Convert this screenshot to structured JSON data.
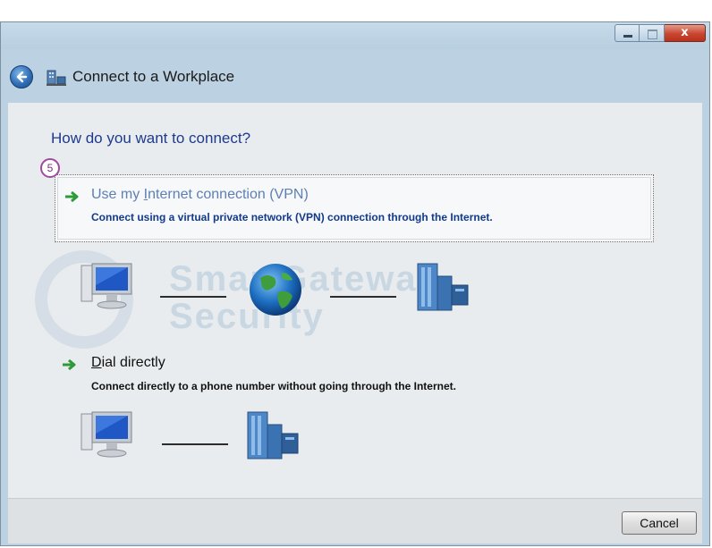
{
  "window": {
    "title": "Connect to a Workplace",
    "controls": {
      "minimize_icon": "minimize-icon",
      "maximize_icon": "maximize-icon",
      "close_glyph": "x"
    }
  },
  "nav": {
    "back_icon": "back-arrow-icon",
    "app_icon": "network-workplace-icon"
  },
  "main": {
    "heading": "How do you want to connect?",
    "step_badge": "5",
    "options": [
      {
        "title_prefix": "Use my ",
        "title_accel": "I",
        "title_suffix": "nternet connection (VPN)",
        "description": "Connect using a virtual private network (VPN) connection through the Internet.",
        "icons": [
          "computer-icon",
          "globe-icon",
          "server-icon"
        ]
      },
      {
        "title_accel": "D",
        "title_suffix": "ial directly",
        "description": "Connect directly to a phone number without going through the Internet.",
        "icons": [
          "computer-icon",
          "server-icon"
        ]
      }
    ]
  },
  "watermark": {
    "line1": "SmartGateway",
    "line2": "Security"
  },
  "footer": {
    "cancel_label": "Cancel"
  },
  "colors": {
    "heading": "#1e3a8c",
    "description": "#123a8c",
    "accent_arrow": "#2e9a3a"
  }
}
